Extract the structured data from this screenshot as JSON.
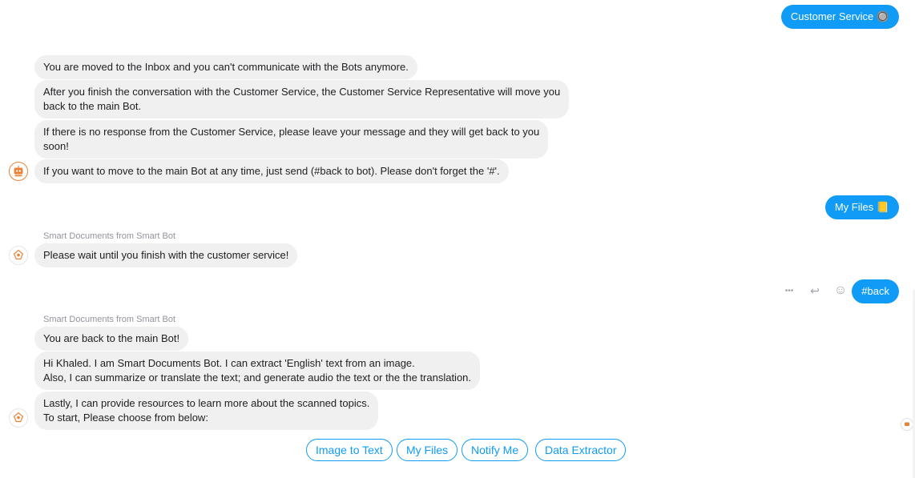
{
  "outgoing": {
    "customer_service": "Customer Service 🔘",
    "my_files": "My Files 📒",
    "back": "#back"
  },
  "group1": {
    "messages": [
      "You are moved to the Inbox and you can't communicate with the Bots anymore.",
      "After you finish the conversation with the Customer Service, the Customer Service Representative will move you\nback to the main Bot.",
      "If there is no response from the Customer Service, please leave your message and they will get back to you\nsoon!",
      "If you want to move to the main Bot at any time, just send (#back to bot). Please don't forget the '#'."
    ]
  },
  "group2": {
    "sender": "Smart Documents from Smart Bot",
    "message": "Please wait until you finish with the customer service!"
  },
  "group3": {
    "sender": "Smart Documents from Smart Bot",
    "messages": [
      "You are back to the main Bot!",
      "Hi Khaled. I am Smart Documents Bot. I can extract 'English' text from an image.\nAlso, I can summarize or translate the text; and generate audio the text or the the translation.",
      "Lastly, I can provide resources to learn more about the scanned topics.\nTo start, Please choose from below:"
    ]
  },
  "quick_replies": [
    "Image to Text",
    "My Files",
    "Notify Me",
    "Data Extractor"
  ],
  "message_actions": {
    "more": "•••",
    "reply": "↩",
    "react": "☺"
  },
  "colors": {
    "accent": "#0f9bf6",
    "incoming_bubble": "#f1f0f0",
    "bot_orange": "#e8833a"
  },
  "icons": {
    "bot_avatar": "smart-bot-logo-icon",
    "more": "more-dots-icon",
    "reply": "reply-icon",
    "react": "smiley-icon"
  }
}
